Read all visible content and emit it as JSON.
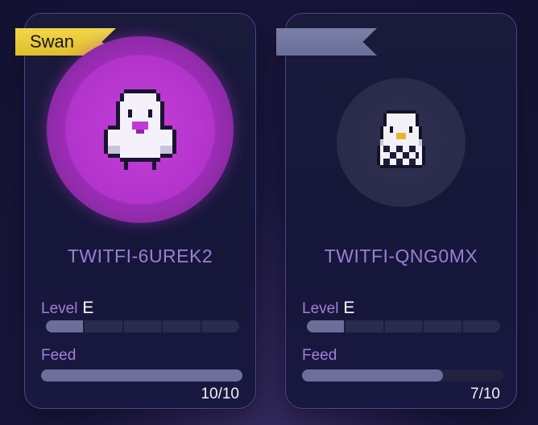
{
  "cards": [
    {
      "ribbon_label": "Swan",
      "ribbon_style": "gold",
      "avatar_icon": "pixel-ghost-purple-beak",
      "name": "TWITFI-6UREK2",
      "level_label": "Level",
      "level_grade": "E",
      "level_segments_total": 5,
      "level_segments_filled": 1,
      "feed_label": "Feed",
      "feed_current": 10,
      "feed_max": 10,
      "feed_count_text": "10/10"
    },
    {
      "ribbon_label": "",
      "ribbon_style": "muted",
      "avatar_icon": "pixel-penguin-checkered",
      "name": "TWITFI-QNG0MX",
      "level_label": "Level",
      "level_grade": "E",
      "level_segments_total": 5,
      "level_segments_filled": 1,
      "feed_label": "Feed",
      "feed_current": 7,
      "feed_max": 10,
      "feed_count_text": "7/10"
    }
  ],
  "colors": {
    "ribbon_gold": "#e6c534",
    "avatar_purple": "#c43ed8",
    "name_text": "#9a7fd4",
    "label_text": "#a27fd8",
    "bar_fill": "#6b6f9a"
  }
}
